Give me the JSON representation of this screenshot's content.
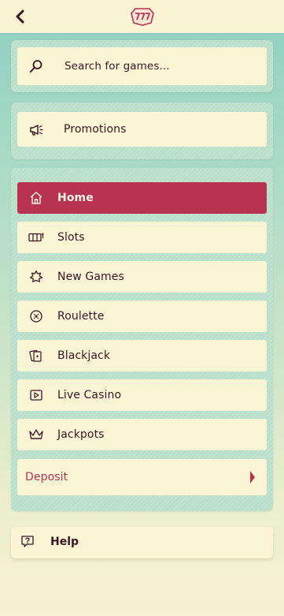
{
  "header": {
    "back_icon": "chevron-left-icon",
    "logo_icon": "777-logo"
  },
  "search": {
    "label": "Search for games...",
    "icon": "search-icon"
  },
  "promotions": {
    "label": "Promotions",
    "icon": "megaphone-icon"
  },
  "menu": {
    "items": [
      {
        "label": "Home",
        "icon": "home-icon",
        "active": true
      },
      {
        "label": "Slots",
        "icon": "slot-reels-icon"
      },
      {
        "label": "New Games",
        "icon": "sparkle-badge-icon"
      },
      {
        "label": "Roulette",
        "icon": "roulette-icon"
      },
      {
        "label": "Blackjack",
        "icon": "cards-icon"
      },
      {
        "label": "Live Casino",
        "icon": "play-icon"
      },
      {
        "label": "Jackpots",
        "icon": "crown-icon"
      }
    ],
    "deposit_label": "Deposit"
  },
  "help": {
    "label": "Help",
    "icon": "question-bubble-icon"
  },
  "colors": {
    "accent": "#b83352",
    "text": "#3b1424",
    "card": "#fcf5d5",
    "panel": "#b9dfcb"
  }
}
